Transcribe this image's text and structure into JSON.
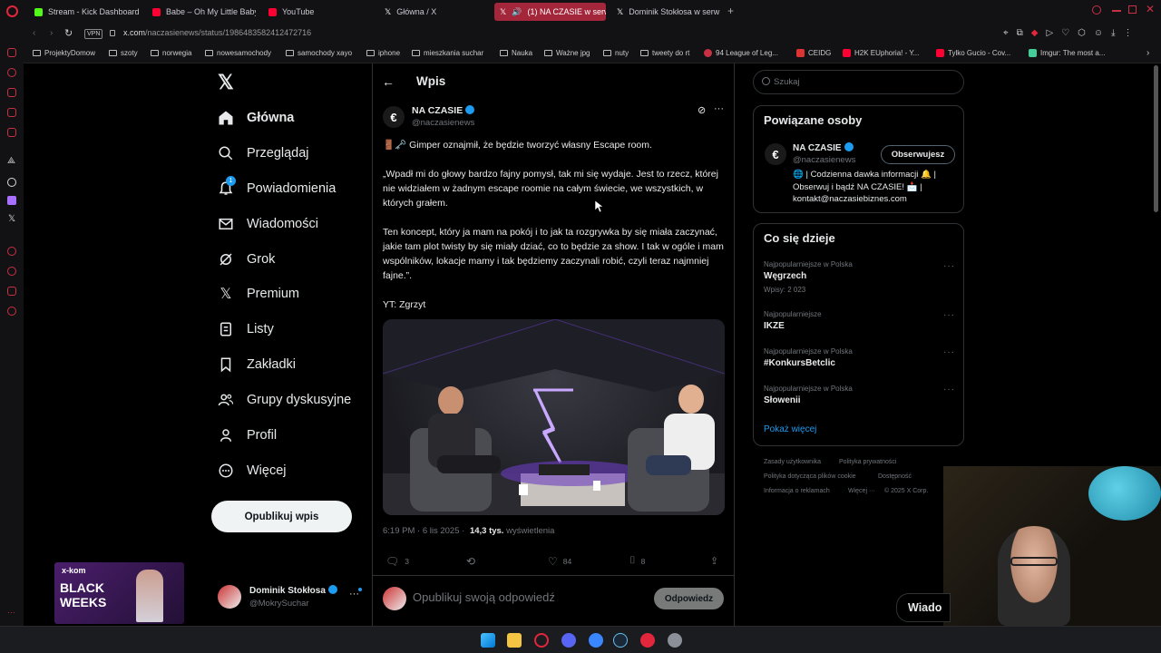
{
  "browser": {
    "tabs": [
      {
        "title": "Stream - Kick Dashboard",
        "color": "#53fc18"
      },
      {
        "title": "Babe – Oh My Little Baby",
        "color": "#ff0033"
      },
      {
        "title": "YouTube",
        "color": "#ff0033"
      },
      {
        "title": "Główna / X",
        "color": "#ffffff"
      },
      {
        "title": "(1) NA CZASIE w serw",
        "color": "#ffffff"
      },
      {
        "title": "Dominik Stokłosa w serw",
        "color": "#ffffff"
      }
    ],
    "new_tab_label": "+",
    "vpn_label": "VPN",
    "url_host": "x.com",
    "url_path": "/naczasienews/status/1986483582412472716",
    "bookmarks": [
      "ProjektyDomow",
      "szoty",
      "norwegia",
      "nowesamochody",
      "samochody xayo",
      "iphone",
      "mieszkania suchar",
      "Nauka",
      "Ważne jpg",
      "nuty",
      "tweety do rt",
      "94 League of Leg...",
      "CEIDG",
      "H2K EUphoria! - Y...",
      "Tylko Gucio - Cov...",
      "Imgur: The most a..."
    ]
  },
  "nav": {
    "items": [
      {
        "label": "Główna",
        "icon": "home-icon"
      },
      {
        "label": "Przeglądaj",
        "icon": "search-icon"
      },
      {
        "label": "Powiadomienia",
        "icon": "bell-icon",
        "badge": "1"
      },
      {
        "label": "Wiadomości",
        "icon": "mail-icon"
      },
      {
        "label": "Grok",
        "icon": "grok-icon"
      },
      {
        "label": "Premium",
        "icon": "x-logo-icon"
      },
      {
        "label": "Listy",
        "icon": "list-icon"
      },
      {
        "label": "Zakładki",
        "icon": "bookmark-icon"
      },
      {
        "label": "Grupy dyskusyjne",
        "icon": "people-icon"
      },
      {
        "label": "Profil",
        "icon": "person-icon"
      },
      {
        "label": "Więcej",
        "icon": "more-circle-icon"
      }
    ],
    "post_button": "Opublikuj wpis",
    "account_name": "Dominik Stokłosa",
    "account_handle": "@MokrySuchar"
  },
  "header": {
    "title": "Wpis"
  },
  "tweet": {
    "author_name": "NA CZASIE",
    "author_handle": "@naczasienews",
    "paragraphs": [
      "🚪🗝️ Gimper oznajmił, że będzie tworzyć własny Escape room.",
      "„Wpadł mi do głowy bardzo fajny pomysł, tak mi się wydaje. Jest to rzecz, której nie widziałem w żadnym escape roomie na całym świecie, we wszystkich, w których grałem.",
      "Ten koncept, który ja mam na pokój i to jak ta rozgrywka by się miała zaczynać, jakie tam plot twisty by się miały dziać, co to będzie za show. I tak w ogóle i mam wspólników, lokacje mamy i tak będziemy zaczynali robić, czyli teraz najmniej fajne.”.",
      "YT: Zgrzyt"
    ],
    "time": "6:19 PM · 6 lis 2025 ·",
    "views_count": "14,3 tys.",
    "views_label": "wyświetlenia",
    "replies": "3",
    "reposts": "",
    "likes": "84",
    "bookmarks": "8",
    "reply_placeholder": "Opublikuj swoją odpowiedź",
    "reply_button": "Odpowiedz"
  },
  "sidebar": {
    "search_placeholder": "Szukaj",
    "related_title": "Powiązane osoby",
    "related": {
      "name": "NA CZASIE",
      "handle": "@naczasienews",
      "bio": "🌐 | Codzienna dawka informacji 🔔 | Obserwuj i bądź NA CZASIE! 📩 | kontakt@naczasiebiznes.com",
      "button": "Obserwujesz"
    },
    "trends_title": "Co się dzieje",
    "trends": [
      {
        "category": "Najpopularniejsze w Polska",
        "name": "Węgrzech",
        "count": "Wpisy: 2 023"
      },
      {
        "category": "Najpopularniejsze",
        "name": "IKZE",
        "count": ""
      },
      {
        "category": "Najpopularniejsze w Polska",
        "name": "#KonkursBetclic",
        "count": ""
      },
      {
        "category": "Najpopularniejsze w Polska",
        "name": "Słowenii",
        "count": ""
      }
    ],
    "show_more": "Pokaż więcej",
    "footer": [
      "Zasady użytkownika",
      "Polityka prywatności",
      "Polityka dotycząca plików cookie",
      "Dostępność",
      "Informacja o reklamach",
      "Więcej ···",
      "© 2025 X Corp."
    ]
  },
  "messages_popup": "Wiado",
  "ad": {
    "brand": "x-kom",
    "line1": "BLACK",
    "line2": "WEEKS"
  },
  "colors": {
    "accent": "#1d9bf0",
    "browser_accent": "#c83044"
  }
}
